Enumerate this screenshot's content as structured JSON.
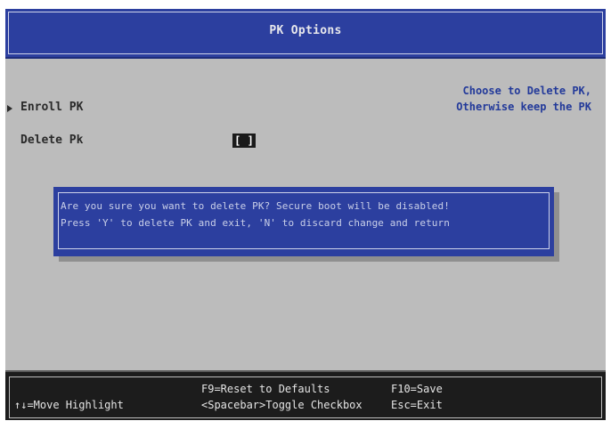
{
  "title": "PK Options",
  "menu": {
    "enroll_label": "Enroll PK",
    "delete_label": "Delete Pk",
    "delete_checkbox": "[ ]"
  },
  "help": {
    "line1": "Choose to Delete PK,",
    "line2": "Otherwise keep the PK"
  },
  "dialog": {
    "line1": "Are you sure you want to delete PK? Secure boot will be disabled!",
    "line2": "Press 'Y' to delete PK and exit, 'N' to discard change and return"
  },
  "footer": {
    "move": "↑↓=Move Highlight",
    "reset": "F9=Reset to Defaults",
    "toggle": "<Spacebar>Toggle Checkbox",
    "save": "F10=Save",
    "exit": "Esc=Exit"
  },
  "colors": {
    "title_bg": "#2c3f9f",
    "body_bg": "#bcbcbc",
    "help_text": "#233a9a",
    "footer_bg": "#1c1c1c"
  }
}
